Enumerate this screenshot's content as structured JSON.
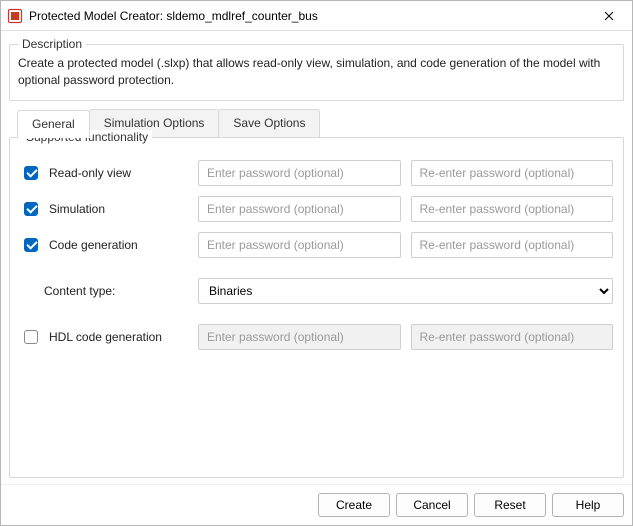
{
  "window": {
    "title": "Protected Model Creator: sldemo_mdlref_counter_bus"
  },
  "description": {
    "legend": "Description",
    "text": "Create a protected model (.slxp) that allows read-only view, simulation, and code generation of the model with optional password protection."
  },
  "tabs": {
    "general": "General",
    "simulation": "Simulation Options",
    "save": "Save Options"
  },
  "group": {
    "title": "Supported functionality",
    "readonly": {
      "label": "Read-only view",
      "checked": true
    },
    "simulation": {
      "label": "Simulation",
      "checked": true
    },
    "codegen": {
      "label": "Code generation",
      "checked": true
    },
    "hdl": {
      "label": "HDL code generation",
      "checked": false
    },
    "pw_placeholder": "Enter password (optional)",
    "pw_re_placeholder": "Re-enter password (optional)",
    "content_type_label": "Content type:",
    "content_type_value": "Binaries"
  },
  "buttons": {
    "create": "Create",
    "cancel": "Cancel",
    "reset": "Reset",
    "help": "Help"
  }
}
